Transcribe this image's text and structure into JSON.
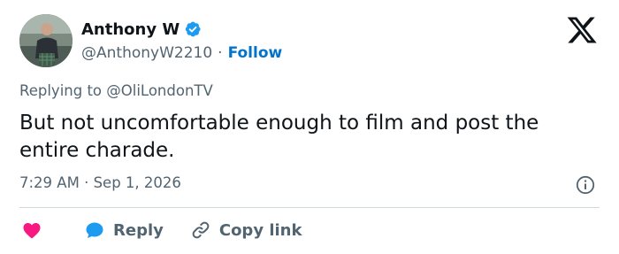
{
  "author": {
    "display_name": "Anthony W",
    "handle": "@AnthonyW2210",
    "separator": "·",
    "follow_label": "Follow"
  },
  "reply_context": {
    "prefix": "Replying to ",
    "target": "@OliLondonTV"
  },
  "tweet": {
    "text": "But not uncomfortable enough to film and post the entire charade.",
    "time": "7:29 AM",
    "separator": "·",
    "date": "Sep 1, 2026"
  },
  "actions": {
    "reply_label": "Reply",
    "copy_link_label": "Copy link"
  },
  "icons": {
    "verified": "verified-badge-icon",
    "logo": "x-logo-icon",
    "info": "info-icon",
    "like": "heart-icon",
    "reply": "chat-bubble-icon",
    "copy": "link-icon"
  },
  "colors": {
    "text": "#0f1419",
    "secondary": "#536471",
    "accent": "#1d9bf0",
    "follow": "#0074cc",
    "like": "#f91880",
    "divider": "#cfd9de"
  }
}
